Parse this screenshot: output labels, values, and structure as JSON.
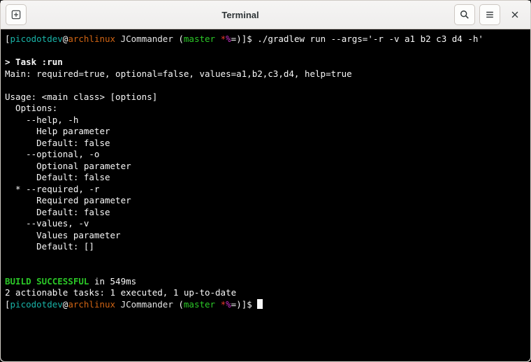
{
  "titlebar": {
    "title": "Terminal"
  },
  "prompt1": {
    "user": "picodotdev",
    "at": "@",
    "host": "archlinux",
    "dir": " JCommander ",
    "branch": "master ",
    "sym_star": "*",
    "sym_pct": "%",
    "sym_eq": "=",
    "prompt_end": ")]$ ",
    "command": "./gradlew run --args='-r -v a1 b2 c3 d4 -h'"
  },
  "output": {
    "task_header": "> Task :run",
    "main_line": "Main: required=true, optional=false, values=a1,b2,c3,d4, help=true",
    "usage": "Usage: <main class> [options]",
    "options_hdr": "  Options:",
    "help_flag": "    --help, -h",
    "help_desc": "      Help parameter",
    "help_def": "      Default: false",
    "opt_flag": "    --optional, -o",
    "opt_desc": "      Optional parameter",
    "opt_def": "      Default: false",
    "req_flag": "  * --required, -r",
    "req_desc": "      Required parameter",
    "req_def": "      Default: false",
    "val_flag": "    --values, -v",
    "val_desc": "      Values parameter",
    "val_def": "      Default: []",
    "build_success": "BUILD SUCCESSFUL",
    "build_time": " in 549ms",
    "tasks_line": "2 actionable tasks: 1 executed, 1 up-to-date"
  },
  "prompt2": {
    "user": "picodotdev",
    "at": "@",
    "host": "archlinux",
    "dir": " JCommander ",
    "branch": "master ",
    "sym_star": "*",
    "sym_pct": "%",
    "sym_eq": "=",
    "prompt_end": ")]$ "
  }
}
